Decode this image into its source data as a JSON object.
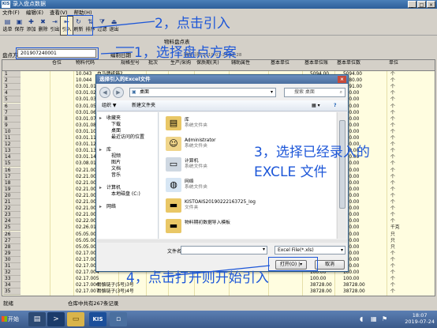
{
  "window": {
    "title": "录入盘点数据",
    "menus": [
      "文件(F)",
      "编辑(E)",
      "查看(V)",
      "帮助(H)"
    ]
  },
  "toolbar": {
    "buttons": [
      {
        "label": "选单",
        "icon": "select-icon"
      },
      {
        "label": "保存",
        "icon": "save-icon"
      },
      {
        "label": "添加",
        "icon": "add-icon"
      },
      {
        "label": "删除",
        "icon": "delete-icon"
      },
      {
        "label": "引出",
        "icon": "export-icon"
      },
      {
        "label": "引入",
        "icon": "import-icon"
      },
      {
        "label": "刷新",
        "icon": "refresh-icon"
      },
      {
        "label": "排序",
        "icon": "sort-icon"
      },
      {
        "label": "过滤",
        "icon": "filter-icon"
      },
      {
        "label": "退出",
        "icon": "exit-icon"
      }
    ]
  },
  "sheet": {
    "title": "物料盘点表",
    "scheme_label": "盘点方案",
    "scheme_value": "201907240001",
    "second_label": "编制日期",
    "date_text": "编制日期:2019-07-24 14:28"
  },
  "grid": {
    "headers": [
      "",
      "仓位",
      "物料代码",
      "规格型号",
      "批次",
      "生产/采购",
      "保质期(天)",
      "辅助属性",
      "基本单位",
      "基本单位账",
      "基本单位数",
      "单位"
    ],
    "rows": [
      {
        "n": "1",
        "code": "10.043",
        "name": "白马牌纸箱2",
        "acct": "5094.00",
        "qty": "5094.00",
        "unit": "个"
      },
      {
        "n": "2",
        "code": "10.044",
        "name": "纸箱 1号",
        "acct": "1080.00",
        "qty": "1080.00",
        "unit": "个"
      },
      {
        "n": "3",
        "code": "03.01.01",
        "name": "不锈钢管",
        "acct": "5791.00",
        "qty": "5791.00",
        "unit": "个"
      },
      {
        "n": "4",
        "code": "03.01.02",
        "name": "不锈钢件",
        "acct": "100.00",
        "qty": "100.00",
        "unit": "个"
      },
      {
        "n": "5",
        "code": "03.01.03",
        "name": "",
        "acct": "100.00",
        "qty": "100.00",
        "unit": "个"
      },
      {
        "n": "6",
        "code": "03.01.05",
        "name": "",
        "acct": "100.00",
        "qty": "100.00",
        "unit": "个"
      },
      {
        "n": "7",
        "code": "03.01.06",
        "name": "",
        "acct": "100.00",
        "qty": "100.00",
        "unit": "个"
      },
      {
        "n": "8",
        "code": "03.01.07",
        "name": "",
        "acct": "100.00",
        "qty": "100.00",
        "unit": "个"
      },
      {
        "n": "9",
        "code": "03.01.08",
        "name": "",
        "acct": "100.00",
        "qty": "100.00",
        "unit": "个"
      },
      {
        "n": "10",
        "code": "03.01.10",
        "name": "",
        "acct": "100.00",
        "qty": "100.00",
        "unit": "个"
      },
      {
        "n": "11",
        "code": "03.01.11",
        "name": "",
        "acct": "100.00",
        "qty": "100.00",
        "unit": "个"
      },
      {
        "n": "12",
        "code": "03.01.12",
        "name": "",
        "acct": "100.00",
        "qty": "100.00",
        "unit": "个"
      },
      {
        "n": "13",
        "code": "03.01.13",
        "name": "",
        "acct": "100.00",
        "qty": "100.00",
        "unit": "个"
      },
      {
        "n": "14",
        "code": "03.01.14",
        "name": "",
        "acct": "100.00",
        "qty": "100.00",
        "unit": "个"
      },
      {
        "n": "15",
        "code": "03.08.01",
        "name": "",
        "acct": "100.00",
        "qty": "100.00",
        "unit": "个"
      },
      {
        "n": "16",
        "code": "02.21.001",
        "name": "",
        "acct": "100.00",
        "qty": "100.00",
        "unit": "个"
      },
      {
        "n": "17",
        "code": "02.21.002",
        "name": "",
        "acct": "100.00",
        "qty": "100.00",
        "unit": "个"
      },
      {
        "n": "18",
        "code": "02.21.003",
        "name": "",
        "acct": "100.00",
        "qty": "100.00",
        "unit": "个"
      },
      {
        "n": "19",
        "code": "02.21.004",
        "name": "",
        "acct": "100.00",
        "qty": "100.00",
        "unit": "个"
      },
      {
        "n": "20",
        "code": "02.21.005",
        "name": "",
        "acct": "100.00",
        "qty": "100.00",
        "unit": "个"
      },
      {
        "n": "21",
        "code": "02.21.006",
        "name": "",
        "acct": "100.00",
        "qty": "100.00",
        "unit": "个"
      },
      {
        "n": "22",
        "code": "02.21.007",
        "name": "",
        "acct": "100.00",
        "qty": "100.00",
        "unit": "个"
      },
      {
        "n": "23",
        "code": "02.21.009",
        "name": "",
        "acct": "100.00",
        "qty": "100.00",
        "unit": "个"
      },
      {
        "n": "24",
        "code": "02.22.001",
        "name": "",
        "acct": "100.00",
        "qty": "100.00",
        "unit": "个"
      },
      {
        "n": "25",
        "code": "02.26.01",
        "name": "",
        "acct": "100.00",
        "qty": "100.00",
        "unit": "千克"
      },
      {
        "n": "26",
        "code": "05.05.001",
        "name": "",
        "acct": "100.00",
        "qty": "100.00",
        "unit": "只"
      },
      {
        "n": "27",
        "code": "05.05.002",
        "name": "",
        "acct": "100.00",
        "qty": "100.00",
        "unit": "只"
      },
      {
        "n": "28",
        "code": "05.05.003",
        "name": "",
        "acct": "100.00",
        "qty": "100.00",
        "unit": "只"
      },
      {
        "n": "29",
        "code": "02.17.001",
        "name": "",
        "acct": "100.00",
        "qty": "100.00",
        "unit": "个"
      },
      {
        "n": "30",
        "code": "02.17.002",
        "name": "",
        "acct": "100.00",
        "qty": "100.00",
        "unit": "个"
      },
      {
        "n": "31",
        "code": "02.17.003",
        "name": "",
        "acct": "100.00",
        "qty": "100.00",
        "unit": "个"
      },
      {
        "n": "32",
        "code": "02.17.004",
        "name": "",
        "acct": "100.00",
        "qty": "100.00",
        "unit": "个"
      },
      {
        "n": "33",
        "code": "02.17.005",
        "name": "",
        "acct": "100.00",
        "qty": "100.00",
        "unit": "个"
      },
      {
        "n": "34",
        "code": "02.17.006",
        "name": "骨骼链子(5号)3号",
        "acct": "38728.00",
        "qty": "38728.00",
        "unit": "个"
      },
      {
        "n": "35",
        "code": "02.17.007",
        "name": "骨骼链子(3号)4号",
        "acct": "38728.00",
        "qty": "38728.00",
        "unit": "个"
      },
      {
        "n": "36",
        "code": "02.17.008",
        "name": "骨骼链子(3号)四川",
        "acct": "T0166.00",
        "qty": "T0166.00",
        "unit": "个"
      }
    ]
  },
  "status": {
    "left": "就绪",
    "mid": "仓库中共有267条记录"
  },
  "dialog": {
    "title": "选择引入的Excel文件",
    "address": "桌面",
    "search_placeholder": "搜索 桌面",
    "cmd_organize": "组织 ▼",
    "cmd_newfolder": "新建文件夹",
    "tree": [
      "收藏夹",
      "下载",
      "桌面",
      "最近访问的位置",
      "库",
      "视频",
      "图片",
      "文档",
      "音乐",
      "计算机",
      "本地磁盘 (C:)",
      "网络"
    ],
    "files": [
      {
        "name": "库",
        "desc": "系统文件夹"
      },
      {
        "name": "Administrator",
        "desc": "系统文件夹"
      },
      {
        "name": "计算机",
        "desc": "系统文件夹"
      },
      {
        "name": "网络",
        "desc": "系统文件夹"
      },
      {
        "name": "KISTOAIS20190222163725_log",
        "desc": "文件夹"
      },
      {
        "name": "物料期初数据导入模板",
        "desc": ""
      }
    ],
    "filename_label": "文件名(N):",
    "filename_value": "",
    "filetype": "Excel File(*.xls)",
    "open_label": "打开(O)",
    "cancel_label": "取消"
  },
  "annotations": {
    "step1": "1，选择盘点方案",
    "step2": "2，点击引入",
    "step3a": "3，选择已经录入的",
    "step3b": "EXCLE 文件",
    "step4": "4，点击打开则开始引入"
  },
  "taskbar": {
    "start": "开始",
    "time": "18:07",
    "date": "2019-07-24"
  }
}
